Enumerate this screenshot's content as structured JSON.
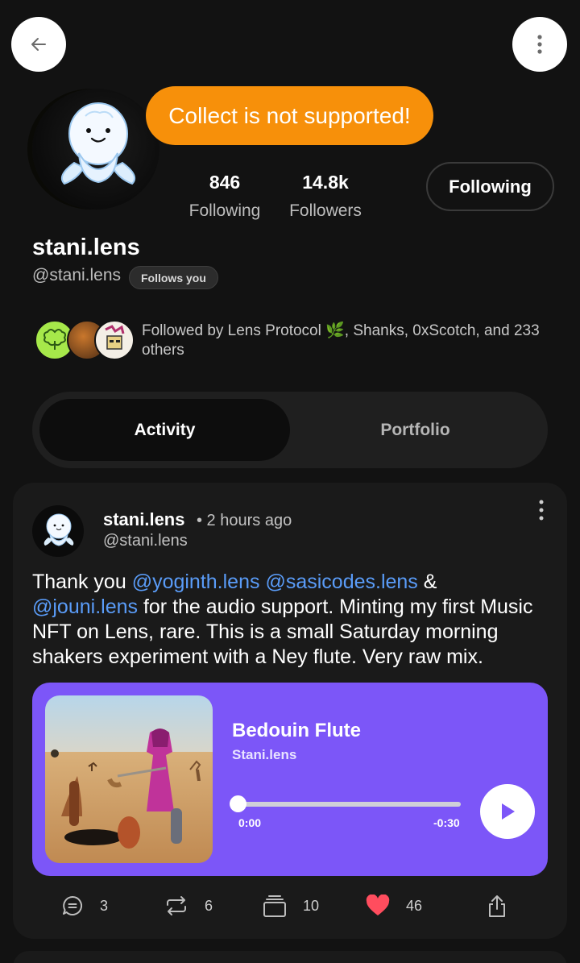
{
  "colors": {
    "background": "#121212",
    "toast": "#f7900a",
    "mention": "#5a9cf8",
    "music_card": "#7c56f8",
    "like": "#ff4d5e"
  },
  "header": {
    "back_icon": "arrow-left-icon",
    "more_icon": "more-vertical-icon"
  },
  "toast": {
    "message": "Collect is not supported!"
  },
  "profile": {
    "display_name": "stani.lens",
    "handle": "@stani.lens",
    "follows_you": "Follows you",
    "stats": {
      "following_count": "846",
      "following_label": "Following",
      "followers_count": "14.8k",
      "followers_label": "Followers"
    },
    "follow_button": "Following",
    "followed_by": "Followed by Lens Protocol 🌿, Shanks, 0xScotch, and 233 others"
  },
  "tabs": [
    {
      "label": "Activity",
      "selected": true
    },
    {
      "label": "Portfolio",
      "selected": false
    }
  ],
  "post": {
    "author_name": "stani.lens",
    "time": "• 2 hours ago",
    "author_handle": "@stani.lens",
    "body": {
      "t1": "Thank you ",
      "m1": "@yoginth.lens",
      "t2": " ",
      "m2": "@sasicodes.lens",
      "t3": " & ",
      "m3": "@jouni.lens",
      "t4": " for the audio support. Minting my first Music NFT on Lens, rare. This is a small Saturday morning shakers experiment with a Ney flute. Very raw mix."
    },
    "music": {
      "title": "Bedouin Flute",
      "artist": "Stani.lens",
      "current_time": "0:00",
      "remaining_time": "-0:30",
      "progress": 0
    },
    "actions": {
      "comments": "3",
      "mirrors": "6",
      "collects": "10",
      "likes": "46"
    }
  }
}
